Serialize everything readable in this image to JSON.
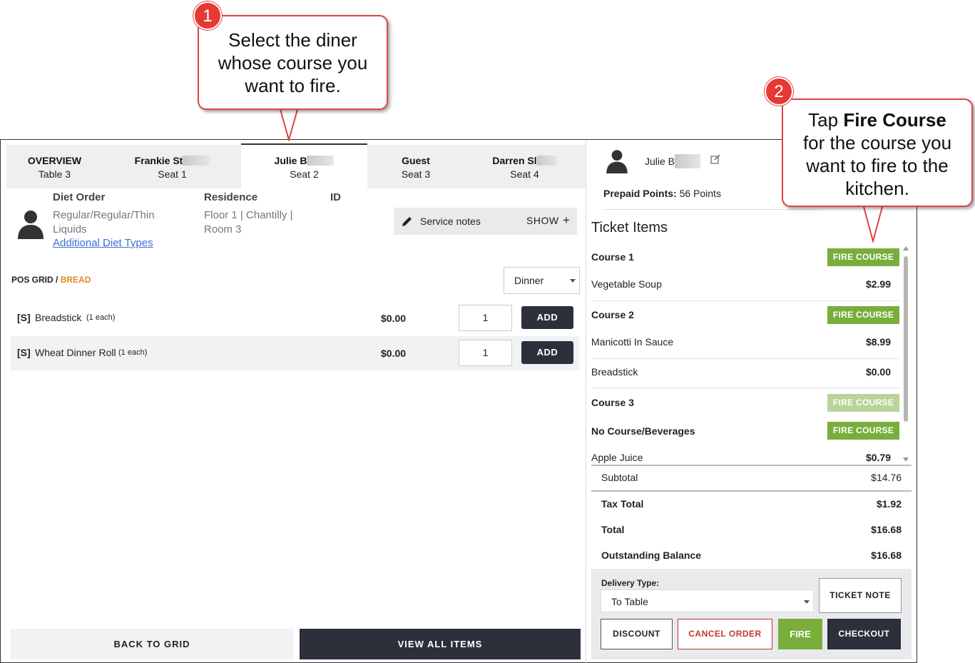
{
  "tabs": [
    {
      "name": "OVERVIEW",
      "sub": "Table 3"
    },
    {
      "name": "Frankie St",
      "sub": "Seat 1"
    },
    {
      "name": "Julie B",
      "sub": "Seat 2"
    },
    {
      "name": "Guest",
      "sub": "Seat 3"
    },
    {
      "name": "Darren Sl",
      "sub": "Seat 4"
    }
  ],
  "diner": {
    "diet_label": "Diet Order",
    "diet_value_1": "Regular/Regular/Thin",
    "diet_value_2": "Liquids",
    "diet_link": "Additional Diet Types",
    "residence_label": "Residence",
    "residence_1": "Floor 1 | Chantilly |",
    "residence_2": "Room 3",
    "id_label": "ID",
    "service_notes": "Service notes",
    "show": "SHOW"
  },
  "pos": {
    "breadcrumb_root": "POS GRID /",
    "breadcrumb_current": "BREAD",
    "meal_select": "Dinner",
    "items": [
      {
        "tag": "[S]",
        "name": "Breadstick",
        "unit": "(1 each)",
        "price": "$0.00",
        "qty": "1",
        "add": "ADD"
      },
      {
        "tag": "[S]",
        "name": "Wheat Dinner Roll",
        "unit": "(1 each)",
        "price": "$0.00",
        "qty": "1",
        "add": "ADD"
      }
    ],
    "back_to_grid": "BACK TO GRID",
    "view_all_items": "VIEW ALL ITEMS"
  },
  "ticket": {
    "diner_name": "Julie B",
    "prepaid_label": "Prepaid Points:",
    "prepaid_value": "56 Points",
    "title": "Ticket Items",
    "fire_course": "FIRE COURSE",
    "course1": "Course 1",
    "course1_items": [
      {
        "name": "Vegetable Soup",
        "price": "$2.99"
      }
    ],
    "course2": "Course 2",
    "course2_items": [
      {
        "name": "Manicotti In Sauce",
        "price": "$8.99"
      },
      {
        "name": "Breadstick",
        "price": "$0.00"
      }
    ],
    "course3": "Course 3",
    "course4": "No Course/Beverages",
    "course4_items": [
      {
        "name": "Apple Juice",
        "price": "$0.79"
      }
    ],
    "subtotal_label": "Subtotal",
    "subtotal": "$14.76",
    "tax_label": "Tax Total",
    "tax": "$1.92",
    "total_label": "Total",
    "total": "$16.68",
    "balance_label": "Outstanding Balance",
    "balance": "$16.68",
    "delivery_label": "Delivery Type:",
    "delivery_value": "To Table",
    "ticket_note": "TICKET NOTE",
    "discount": "DISCOUNT",
    "cancel_order": "CANCEL ORDER",
    "fire": "FIRE",
    "checkout": "CHECKOUT"
  },
  "callouts": {
    "one_num": "1",
    "one_l1": "Select the diner",
    "one_l2": "whose course you",
    "one_l3": "want to fire.",
    "two_num": "2",
    "two_pre": "Tap ",
    "two_bold": "Fire Course",
    "two_l2": "for the course you",
    "two_l3": "want to fire to the",
    "two_l4": "kitchen."
  },
  "colors": {
    "accent_green": "#79ad3c",
    "dark": "#2b303a",
    "orange": "#e08a1e",
    "callout_red": "#d44"
  }
}
